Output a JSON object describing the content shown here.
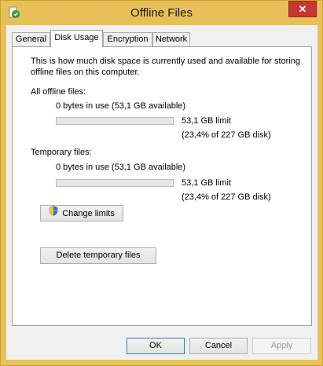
{
  "window": {
    "title": "Offline Files",
    "close_label": "✕"
  },
  "tabs": [
    {
      "label": "General",
      "active": false
    },
    {
      "label": "Disk Usage",
      "active": true
    },
    {
      "label": "Encryption",
      "active": false
    },
    {
      "label": "Network",
      "active": false
    }
  ],
  "disk_usage": {
    "intro_line1": "This is how much disk space is currently used and available for storing",
    "intro_line2": "offline files on this computer.",
    "all_offline": {
      "heading": "All offline files:",
      "usage": "0 bytes in use (53,1 GB available)",
      "limit": "53,1 GB limit",
      "percent": "(23,4% of 227 GB disk)",
      "fill_fraction": 0
    },
    "temporary": {
      "heading": "Temporary files:",
      "usage": "0 bytes in use (53,1 GB available)",
      "limit": "53,1 GB limit",
      "percent": "(23,4% of 227 GB disk)",
      "fill_fraction": 0
    },
    "change_limits_label": "Change limits",
    "delete_temp_label": "Delete temporary files"
  },
  "footer": {
    "ok_label": "OK",
    "cancel_label": "Cancel",
    "apply_label": "Apply"
  },
  "colors": {
    "titlebar": "#e8c05a",
    "close": "#c7372f"
  }
}
